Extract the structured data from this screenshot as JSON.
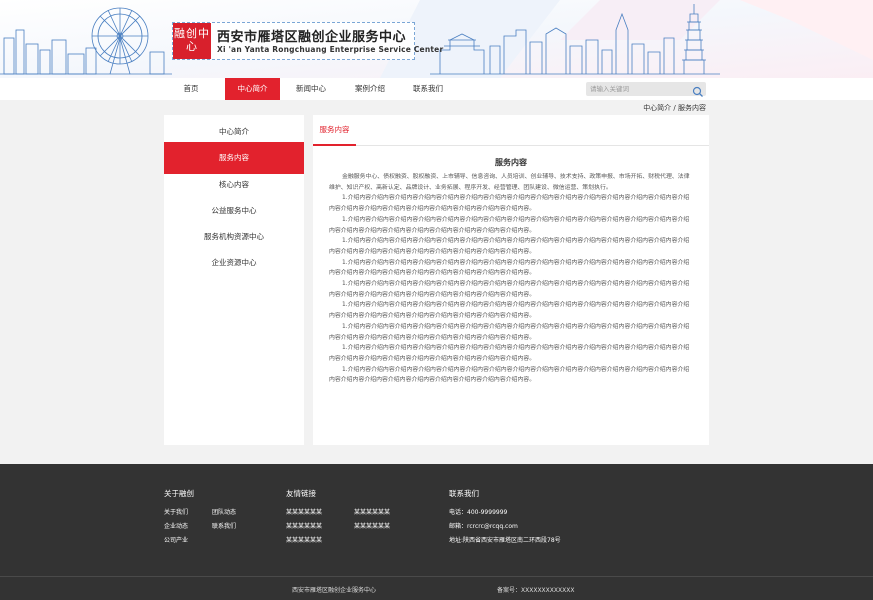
{
  "header": {
    "logo_seal": "融创中心",
    "title_cn": "西安市雁塔区融创企业服务中心",
    "title_en": "Xi 'an Yanta Rongchuang Enterprise Service Center"
  },
  "nav": {
    "items": [
      {
        "label": "首页"
      },
      {
        "label": "中心简介"
      },
      {
        "label": "新闻中心"
      },
      {
        "label": "案例介绍"
      },
      {
        "label": "联系我们"
      }
    ],
    "active_index": 1
  },
  "search": {
    "placeholder": "请输入关键词"
  },
  "breadcrumb": "中心简介 / 服务内容",
  "sidebar": {
    "items": [
      {
        "label": "中心简介"
      },
      {
        "label": "服务内容"
      },
      {
        "label": "核心内容"
      },
      {
        "label": "公益服务中心"
      },
      {
        "label": "服务机构资源中心"
      },
      {
        "label": "企业资源中心"
      }
    ],
    "active_index": 1
  },
  "content": {
    "tab_label": "服务内容",
    "title": "服务内容",
    "intro": "金融服务中心、债权融资、股权融资、上市辅导、信息咨询、人员培训、创业辅导、技术支持、政策申报、市场开拓、财税代理、法律维护、知识产权、高新认定、品牌设计、业务拓展、程序开发、经营管理、团队建设、微信运营、策划执行。",
    "paragraphs": [
      "1.介绍内容介绍内容介绍内容介绍内容介绍内容介绍内容介绍内容介绍内容介绍内容介绍内容介绍内容介绍内容介绍内容介绍内容介绍内容介绍内容介绍内容介绍内容介绍内容介绍内容介绍内容介绍内容介绍内容。",
      "1.介绍内容介绍内容介绍内容介绍内容介绍内容介绍内容介绍内容介绍内容介绍内容介绍内容介绍内容介绍内容介绍内容介绍内容介绍内容介绍内容介绍内容介绍内容介绍内容介绍内容介绍内容介绍内容介绍内容。",
      "1.介绍内容介绍内容介绍内容介绍内容介绍内容介绍内容介绍内容介绍内容介绍内容介绍内容介绍内容介绍内容介绍内容介绍内容介绍内容介绍内容介绍内容介绍内容介绍内容介绍内容介绍内容介绍内容介绍内容。",
      "1.介绍内容介绍内容介绍内容介绍内容介绍内容介绍内容介绍内容介绍内容介绍内容介绍内容介绍内容介绍内容介绍内容介绍内容介绍内容介绍内容介绍内容介绍内容介绍内容介绍内容介绍内容介绍内容介绍内容。",
      "1.介绍内容介绍内容介绍内容介绍内容介绍内容介绍内容介绍内容介绍内容介绍内容介绍内容介绍内容介绍内容介绍内容介绍内容介绍内容介绍内容介绍内容介绍内容介绍内容介绍内容介绍内容介绍内容介绍内容。",
      "1.介绍内容介绍内容介绍内容介绍内容介绍内容介绍内容介绍内容介绍内容介绍内容介绍内容介绍内容介绍内容介绍内容介绍内容介绍内容介绍内容介绍内容介绍内容介绍内容介绍内容介绍内容介绍内容介绍内容。",
      "1.介绍内容介绍内容介绍内容介绍内容介绍内容介绍内容介绍内容介绍内容介绍内容介绍内容介绍内容介绍内容介绍内容介绍内容介绍内容介绍内容介绍内容介绍内容介绍内容介绍内容介绍内容介绍内容介绍内容。",
      "1.介绍内容介绍内容介绍内容介绍内容介绍内容介绍内容介绍内容介绍内容介绍内容介绍内容介绍内容介绍内容介绍内容介绍内容介绍内容介绍内容介绍内容介绍内容介绍内容介绍内容介绍内容介绍内容介绍内容。",
      "1.介绍内容介绍内容介绍内容介绍内容介绍内容介绍内容介绍内容介绍内容介绍内容介绍内容介绍内容介绍内容介绍内容介绍内容介绍内容介绍内容介绍内容介绍内容介绍内容介绍内容介绍内容介绍内容介绍内容。"
    ]
  },
  "footer": {
    "about": {
      "title": "关于融创",
      "links": [
        "关于我们",
        "团队动态",
        "企业动态",
        "联系我们",
        "公司产业"
      ]
    },
    "friends": {
      "title": "友情链接",
      "links": [
        "某某某某某某",
        "某某某某某某",
        "某某某某某某",
        "某某某某某某",
        "某某某某某某"
      ]
    },
    "contact": {
      "title": "联系我们",
      "phone": "电话：400-9999999",
      "email": "邮箱：rcrcrc@rcqq.com",
      "address": "地址:陕西省西安市雁塔区南二环西段78号"
    },
    "copyright": "西安市雁塔区融创企业服务中心",
    "icp": "备案号：XXXXXXXXXXXXX"
  },
  "colors": {
    "accent": "#e2222d",
    "footer_bg": "#333333",
    "page_bg": "#f2f2f2",
    "skyline": "#4a7fc1"
  }
}
